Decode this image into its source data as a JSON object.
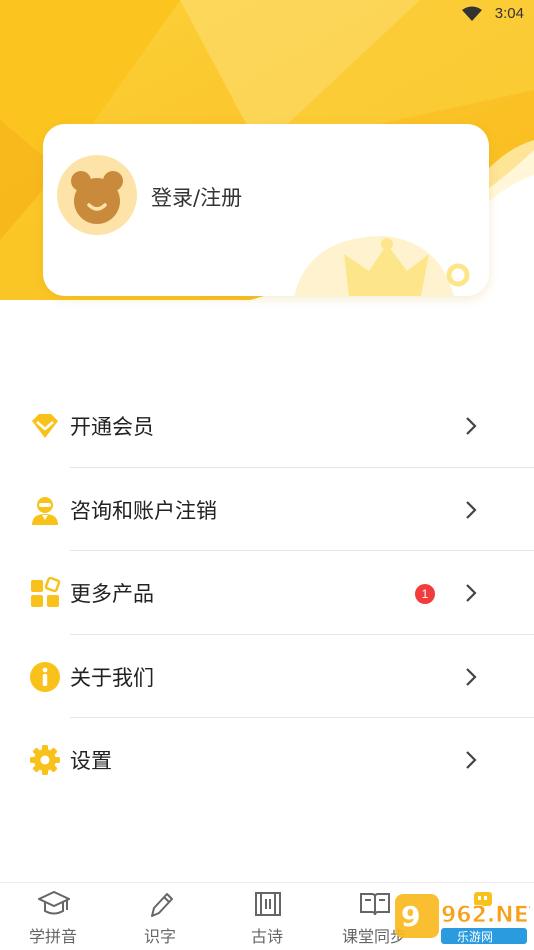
{
  "status_bar": {
    "time": "3:04"
  },
  "profile": {
    "login_label": "登录/注册"
  },
  "menu": {
    "items": [
      {
        "label": "开通会员",
        "icon": "diamond-icon"
      },
      {
        "label": "咨询和账户注销",
        "icon": "support-agent-icon"
      },
      {
        "label": "更多产品",
        "icon": "apps-grid-icon",
        "badge": "1"
      },
      {
        "label": "关于我们",
        "icon": "info-icon"
      },
      {
        "label": "设置",
        "icon": "gear-icon"
      }
    ]
  },
  "bottom_nav": {
    "items": [
      {
        "label": "学拼音",
        "icon": "graduation-cap-icon"
      },
      {
        "label": "识字",
        "icon": "pencil-icon"
      },
      {
        "label": "古诗",
        "icon": "scroll-icon"
      },
      {
        "label": "课堂同步",
        "icon": "book-icon"
      },
      {
        "label": "",
        "icon": "profile-tab-icon"
      }
    ]
  },
  "watermark": {
    "text": "962.NET",
    "subtext": "乐游网"
  },
  "colors": {
    "accent": "#f9c21b",
    "accent_light": "#fde3a8",
    "badge": "#f23b3b",
    "text": "#222222"
  }
}
